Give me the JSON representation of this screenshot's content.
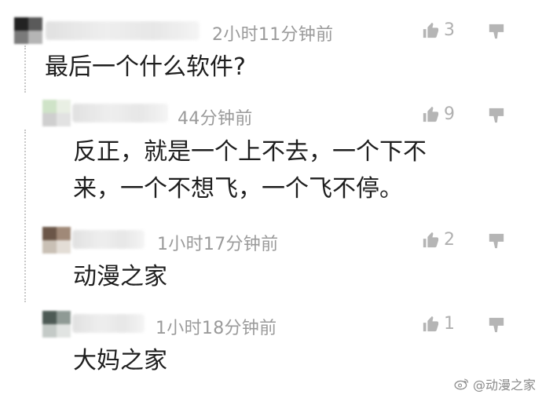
{
  "comments": [
    {
      "time": "2小时11分钟前",
      "text": "最后一个什么软件?",
      "likes": "3",
      "avatar_colors": [
        "#222222",
        "#5a5a5a",
        "#7a7a7a",
        "#b5b5b5"
      ]
    },
    {
      "time": "44分钟前",
      "text_lines": [
        "反正，就是一个上不去，一个下不",
        "来，一个不想飞，一个飞不停。"
      ],
      "likes": "9",
      "avatar_colors": [
        "#cfe3c8",
        "#e9efe4",
        "#cfcfcf",
        "#e2e2e2"
      ]
    },
    {
      "time": "1小时17分钟前",
      "text": "动漫之家",
      "likes": "2",
      "avatar_colors": [
        "#6b5648",
        "#a08978",
        "#c9c0b5",
        "#e3ddd6"
      ]
    },
    {
      "time": "1小时18分钟前",
      "text": "大妈之家",
      "likes": "1",
      "avatar_colors": [
        "#4d5a55",
        "#8f9a95",
        "#c4cac7",
        "#e1e4e2"
      ]
    }
  ],
  "watermark": {
    "handle": "@动漫之家"
  },
  "icons": {
    "like": "thumb-up-icon",
    "dislike": "thumb-down-icon",
    "watermark": "weibo-icon"
  },
  "colors": {
    "time_text": "#9a9a9a",
    "body_text": "#1e1e1e",
    "icon": "#b0b0b0"
  }
}
